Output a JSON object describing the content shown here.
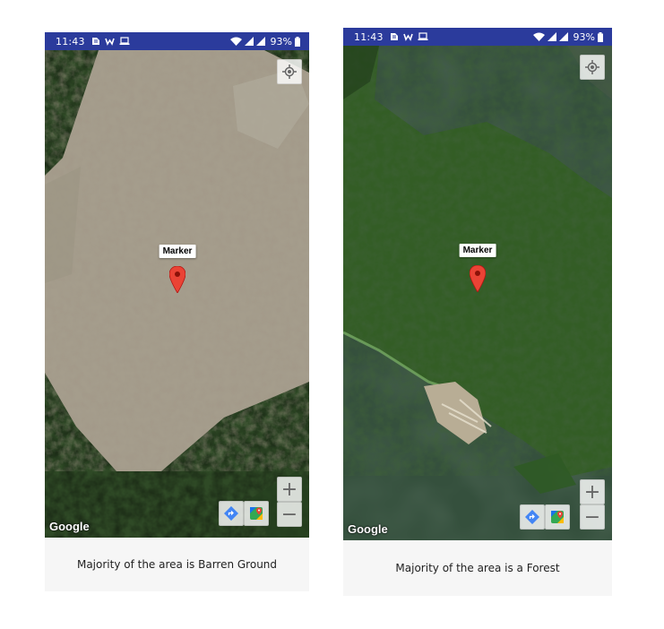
{
  "colors": {
    "status_bar": "#2b3b9c",
    "marker": "#ea4335",
    "caption_background": "#f6f6f6"
  },
  "panels": [
    {
      "status_bar": {
        "time": "11:43",
        "notification_icons": [
          "notification-icon",
          "wearable-icon",
          "laptop-icon"
        ],
        "system_icons": [
          "wifi-icon",
          "signal-icon",
          "signal-icon"
        ],
        "battery": "93%"
      },
      "map": {
        "type": "satellite",
        "marker_label": "Marker",
        "attribution": "Google",
        "controls": [
          "my-location-icon",
          "zoom-in",
          "zoom-out",
          "directions-icon",
          "google-maps-icon"
        ],
        "zoom_in_symbol": "+",
        "zoom_out_symbol": "−"
      },
      "caption": "Majority of the area is Barren Ground"
    },
    {
      "status_bar": {
        "time": "11:43",
        "notification_icons": [
          "notification-icon",
          "wearable-icon",
          "laptop-icon"
        ],
        "system_icons": [
          "wifi-icon",
          "signal-icon",
          "signal-icon"
        ],
        "battery": "93%"
      },
      "map": {
        "type": "satellite",
        "marker_label": "Marker",
        "attribution": "Google",
        "controls": [
          "my-location-icon",
          "zoom-in",
          "zoom-out",
          "directions-icon",
          "google-maps-icon"
        ],
        "zoom_in_symbol": "+",
        "zoom_out_symbol": "−"
      },
      "caption": "Majority of the area is a Forest"
    }
  ]
}
